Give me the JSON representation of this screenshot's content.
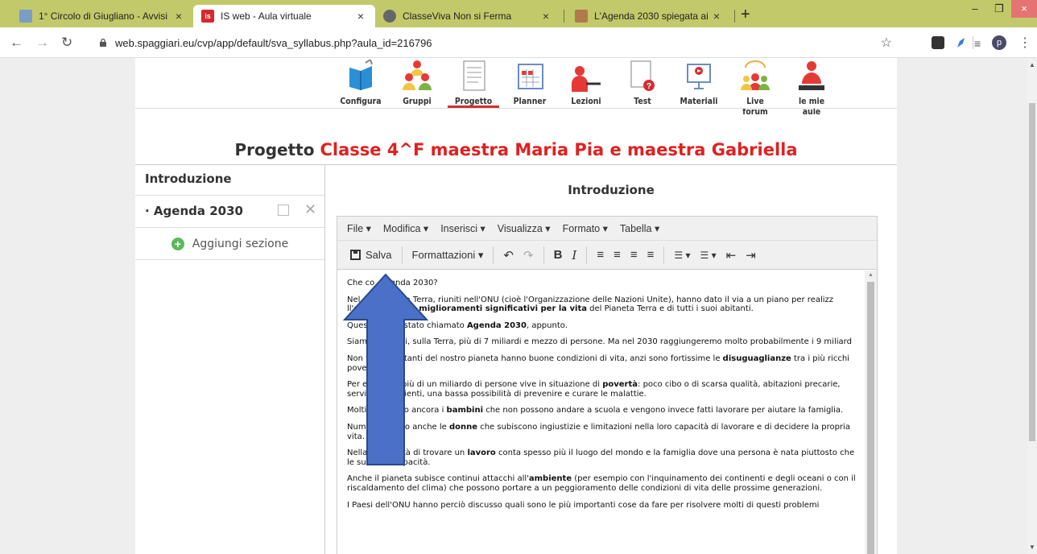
{
  "browser": {
    "tabs": [
      {
        "title": "1° Circolo di Giugliano - Avvisi",
        "close": "×",
        "fav_color": "#7a9cc6",
        "fav_text": ""
      },
      {
        "title": "IS web - Aula virtuale",
        "close": "×",
        "fav_color": "#d9272e",
        "fav_text": "is"
      },
      {
        "title": "ClasseViva Non si Ferma",
        "close": "×",
        "fav_color": "#666666",
        "fav_text": ""
      },
      {
        "title": "L'Agenda 2030 spiegata ai bamb",
        "close": "×",
        "fav_color": "#b07a4a",
        "fav_text": ""
      }
    ],
    "active_tab": 1,
    "new_tab": "+",
    "url": "web.spaggiari.eu/cvp/app/default/sva_syllabus.php?aula_id=216796",
    "profile_initial": "p",
    "colors": {
      "tabstrip": "#c2c96a",
      "window_close": "#e57373"
    }
  },
  "app_toolbar": {
    "items": [
      {
        "label": "Configura",
        "icon": "book-icon"
      },
      {
        "label": "Gruppi",
        "icon": "group-icon"
      },
      {
        "label": "Progetto",
        "icon": "document-icon"
      },
      {
        "label": "Planner",
        "icon": "calendar-icon"
      },
      {
        "label": "Lezioni",
        "icon": "teacher-icon"
      },
      {
        "label": "Test",
        "icon": "quiz-icon"
      },
      {
        "label": "Materiali",
        "icon": "presentation-icon"
      },
      {
        "label": "Live forum",
        "icon": "forum-icon"
      },
      {
        "label": "le mie aule",
        "icon": "classroom-icon"
      }
    ],
    "active": "Progetto",
    "accent": "#d32f2f"
  },
  "project": {
    "prefix": "Progetto",
    "name": "Classe 4^F maestra Maria Pia e maestra Gabriella",
    "name_color": "#e02020"
  },
  "sections": {
    "header": "Introduzione",
    "items": [
      {
        "label": "· Agenda 2030"
      }
    ],
    "add_label": "Aggiungi sezione"
  },
  "content": {
    "title": "Introduzione"
  },
  "editor": {
    "menus": [
      "File ▾",
      "Modifica ▾",
      "Inserisci ▾",
      "Visualizza ▾",
      "Formato ▾",
      "Tabella ▾"
    ],
    "save_label": "Salva",
    "format_label": "Formattazioni ▾",
    "tools": {
      "undo": "↶",
      "redo": "↷",
      "bold": "B",
      "italic": "I",
      "align_left": "≡",
      "align_center": "≡",
      "align_right": "≡",
      "justify": "≡",
      "bullet_list": "☰ ▾",
      "numbered_list": "☰ ▾",
      "outdent": "⇤",
      "indent": "⇥"
    },
    "doc": [
      {
        "parts": [
          {
            "t": "Che co"
          },
          {
            "t": "  "
          },
          {
            "t": "Agenda 2030?"
          }
        ]
      },
      {
        "parts": [
          {
            "t": "Nel"
          },
          {
            "t": "            della Terra, riuniti nell'ONU (cioè l'Organizzazione delle Nazioni Unite), hanno dato il via a un piano per realizz"
          },
          {
            "t": "       ll'arco di 15 anni, "
          },
          {
            "t": "miglioramenti significativi per la vita",
            "b": true
          },
          {
            "t": " del Pianeta Terra e di tutti i suoi abitanti."
          }
        ]
      },
      {
        "parts": [
          {
            "t": "Quest"
          },
          {
            "t": "          è stato chiamato "
          },
          {
            "t": "Agenda 2030",
            "b": true
          },
          {
            "t": ", appunto."
          }
        ]
      },
      {
        "parts": [
          {
            "t": "Siamo"
          },
          {
            "t": "       oggi, sulla Terra, più di 7 miliardi e mezzo di persone. Ma nel 2030 raggiungeremo molto probabilmente i 9 miliard"
          }
        ]
      },
      {
        "parts": [
          {
            "t": "Non tu"
          },
          {
            "t": "       abitanti del nostro pianeta hanno buone condizioni di vita, anzi sono fortissime le "
          },
          {
            "t": "disuguaglianze",
            "b": true
          },
          {
            "t": " tra i più ricchi "
          },
          {
            "t": "       poveri."
          }
        ]
      },
      {
        "parts": [
          {
            "t": "Per esempio, più di un miliardo di persone vive in situazione di "
          },
          {
            "t": "povertà",
            "b": true
          },
          {
            "t": ": poco cibo o di scarsa qualità, abitazioni precarie, servizi insufficienti, una bassa possibilità di prevenire e curare le malattie."
          }
        ]
      },
      {
        "parts": [
          {
            "t": "Moltissimi sono ancora i "
          },
          {
            "t": "bambini",
            "b": true
          },
          {
            "t": " che non possono andare a scuola e vengono invece fatti lavorare per aiutare la famiglia."
          }
        ]
      },
      {
        "parts": [
          {
            "t": "Numerose sono anche le "
          },
          {
            "t": "donne",
            "b": true
          },
          {
            "t": " che subiscono ingiustizie e limitazioni nella loro capacità di lavorare e di decidere la propria vita."
          }
        ]
      },
      {
        "parts": [
          {
            "t": "Nella possibilità di trovare un "
          },
          {
            "t": "lavoro",
            "b": true
          },
          {
            "t": " conta spesso più il luogo del mondo e la famiglia dove una persona è nata piuttosto che le sue reali capacità."
          }
        ]
      },
      {
        "parts": [
          {
            "t": "Anche il pianeta subisce continui attacchi all'"
          },
          {
            "t": "ambiente",
            "b": true
          },
          {
            "t": " (per esempio con l'inquinamento dei continenti e degli oceani o con il riscaldamento del clima) che possono portare a un peggioramento delle condizioni di vita delle prossime generazioni."
          }
        ]
      },
      {
        "parts": [
          {
            "t": "I Paesi dell'ONU hanno perciò discusso quali sono le più importanti cose da fare per risolvere molti di questi problemi"
          }
        ]
      }
    ]
  },
  "annotation": {
    "arrow_color": "#4a70c8",
    "arrow_direction": "up"
  }
}
